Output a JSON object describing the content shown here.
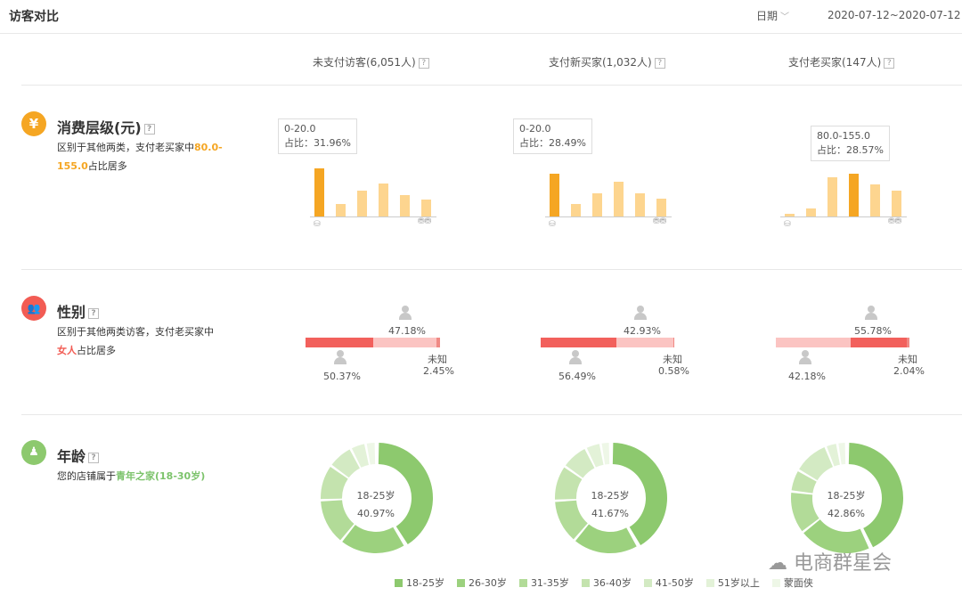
{
  "header": {
    "title": "访客对比",
    "date_label": "日期",
    "date_range": "2020-07-12~2020-07-12"
  },
  "columns": [
    "未支付访客(6,051人)",
    "支付新买家(1,032人)",
    "支付老买家(147人)"
  ],
  "sections": {
    "spend": {
      "icon": "¥",
      "title": "消费层级(元)",
      "desc_pre": "区别于其他两类，支付老买家中",
      "desc_hl": "80.0-155.0",
      "desc_post": "占比居多"
    },
    "gender": {
      "title": "性别",
      "desc_pre": "区别于其他两类访客，支付老买家中",
      "desc_hl": "女人",
      "desc_post": "占比居多"
    },
    "age": {
      "title": "年龄",
      "desc_pre": "您的店铺属于",
      "desc_hl": "青年之家(18-30岁)"
    }
  },
  "spend_charts": [
    {
      "tip_range": "0-20.0",
      "tip_share": "占比：31.96%",
      "values": [
        0.32,
        0.08,
        0.17,
        0.22,
        0.14,
        0.11
      ],
      "highlight": 0
    },
    {
      "tip_range": "0-20.0",
      "tip_share": "占比：28.49%",
      "values": [
        0.28,
        0.08,
        0.15,
        0.23,
        0.15,
        0.12
      ],
      "highlight": 0
    },
    {
      "tip_range": "80.0-155.0",
      "tip_share": "占比：28.57%",
      "values": [
        0.02,
        0.05,
        0.26,
        0.28,
        0.21,
        0.17
      ],
      "highlight": 3
    }
  ],
  "gender_charts": [
    {
      "male": 50.37,
      "female": 47.18,
      "unknown": 2.45,
      "male_label": "50.37%",
      "female_label": "47.18%",
      "unknown_label": "2.45%",
      "unknown_text": "未知"
    },
    {
      "male": 56.49,
      "female": 42.93,
      "unknown": 0.58,
      "male_label": "56.49%",
      "female_label": "42.93%",
      "unknown_label": "0.58%",
      "unknown_text": "未知"
    },
    {
      "male": 42.18,
      "female": 55.78,
      "unknown": 2.04,
      "male_label": "42.18%",
      "female_label": "55.78%",
      "unknown_label": "2.04%",
      "unknown_text": "未知"
    }
  ],
  "age_charts": [
    {
      "label": "18-25岁",
      "pct": "40.97%",
      "values": [
        40.97,
        19.5,
        13.5,
        10.5,
        7.5,
        4.5,
        3.0
      ]
    },
    {
      "label": "18-25岁",
      "pct": "41.67%",
      "values": [
        41.67,
        19.5,
        13.0,
        10.5,
        8.0,
        4.5,
        2.8
      ]
    },
    {
      "label": "18-25岁",
      "pct": "42.86%",
      "values": [
        42.86,
        21.5,
        12.5,
        6.5,
        10.5,
        3.5,
        2.6
      ]
    }
  ],
  "age_legend": [
    "18-25岁",
    "26-30岁",
    "31-35岁",
    "36-40岁",
    "41-50岁",
    "51岁以上",
    "蒙面侠"
  ],
  "age_colors": [
    "#8dc96e",
    "#9cd17e",
    "#b2db98",
    "#c4e3ae",
    "#d3eac3",
    "#e3f2d8",
    "#eef7e7"
  ],
  "colors": {
    "orange": "#f5a623",
    "bar_light": "#fdd58f",
    "male": "#f2605c",
    "female": "#fbc4c2",
    "unknown": "#f08a85"
  },
  "watermark": "电商群星会"
}
